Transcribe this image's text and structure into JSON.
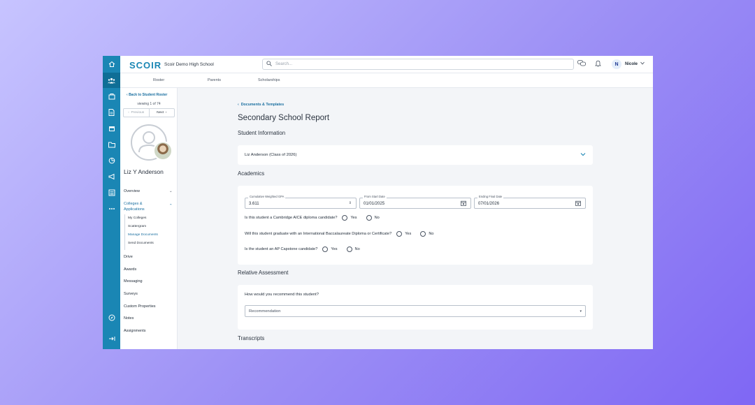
{
  "topbar": {
    "logo": "SCOIR",
    "school": "Scoir Demo High School",
    "search_placeholder": "Search...",
    "user_initial": "N",
    "user_name": "Nicole"
  },
  "subnav": [
    "Roster",
    "Parents",
    "Scholarships"
  ],
  "rail_icons": [
    "home-icon",
    "people-icon",
    "school-icon",
    "document-icon",
    "calendar-icon",
    "folder-icon",
    "chart-icon",
    "megaphone-icon",
    "list-icon",
    "more-icon"
  ],
  "sidebar": {
    "back_label": "Back to Student Roster",
    "viewing": "viewing 1 of 74",
    "previous": "Previous",
    "next": "Next",
    "student_name": "Liz Y Anderson",
    "overview": "Overview",
    "colleges_line1": "Colleges &",
    "colleges_line2": "Applications",
    "sub_items": [
      "My Colleges",
      "Scattergram",
      "Manage Documents",
      "Send Documents"
    ],
    "items": [
      "Drive",
      "Awards",
      "Messaging",
      "Surveys",
      "Custom Properties",
      "Notes",
      "Assignments"
    ]
  },
  "main": {
    "breadcrumb": "Documents & Templates",
    "title": "Secondary School Report",
    "student_info_title": "Student Information",
    "student_value": "Liz Anderson (Class of 2026)",
    "academics_title": "Academics",
    "gpa_label": "Cumulative Weighted GPA",
    "gpa_value": "3.611",
    "start_label": "From Start Date",
    "start_value": "01/01/2025",
    "end_label": "Ending Final Date",
    "end_value": "07/01/2026",
    "q1": "Is this student a Cambridge AICE diploma candidate?",
    "q2": "Will this student graduate with an International Baccalaureate Diploma or Certificate?",
    "q3": "Is the student an AP Capstone candidate?",
    "yes": "Yes",
    "no": "No",
    "relative_title": "Relative Assessment",
    "recommend_q": "How would you recommend this student?",
    "recommend_placeholder": "Recommendation",
    "transcripts_title": "Transcripts"
  },
  "colors": {
    "brand": "#1a86b4",
    "rail": "#1a86b4",
    "link": "#1a6fa0"
  }
}
